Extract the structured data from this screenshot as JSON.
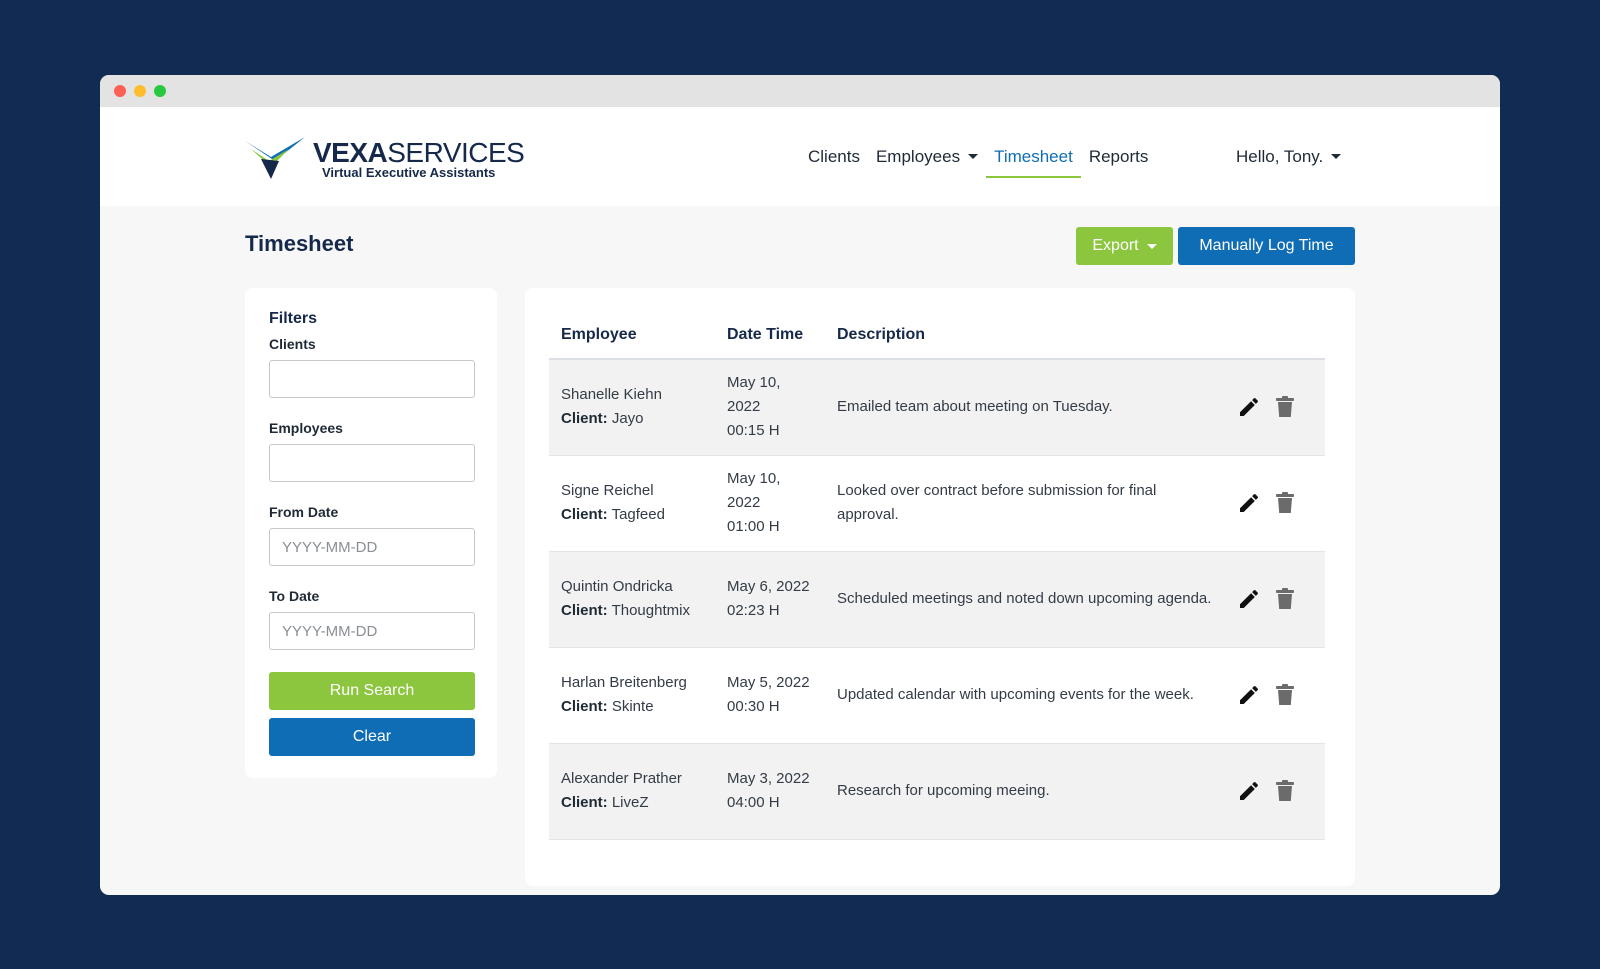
{
  "brand": {
    "name_strong": "VEXA",
    "name_light": "SERVICES",
    "tagline": "Virtual Executive Assistants"
  },
  "nav": {
    "links": [
      {
        "label": "Clients"
      },
      {
        "label": "Employees",
        "dropdown": true
      },
      {
        "label": "Timesheet",
        "active": true
      },
      {
        "label": "Reports"
      }
    ],
    "user_greeting": "Hello, Tony."
  },
  "page": {
    "title": "Timesheet",
    "export_label": "Export",
    "manual_log_label": "Manually Log Time"
  },
  "filters": {
    "title": "Filters",
    "clients_label": "Clients",
    "clients_value": "",
    "employees_label": "Employees",
    "employees_value": "",
    "from_date_label": "From Date",
    "from_date_placeholder": "YYYY-MM-DD",
    "to_date_label": "To Date",
    "to_date_placeholder": "YYYY-MM-DD",
    "run_search_label": "Run Search",
    "clear_label": "Clear"
  },
  "table": {
    "headers": [
      "Employee",
      "Date Time",
      "Description"
    ],
    "client_prefix": "Client:",
    "rows": [
      {
        "employee": "Shanelle Kiehn",
        "client": "Jayo",
        "date": "May 10, 2022",
        "time": "00:15 H",
        "description": "Emailed team about meeting on Tuesday."
      },
      {
        "employee": "Signe Reichel",
        "client": "Tagfeed",
        "date": "May 10, 2022",
        "time": "01:00 H",
        "description": "Looked over contract before submission for final approval."
      },
      {
        "employee": "Quintin Ondricka",
        "client": "Thoughtmix",
        "date": "May 6, 2022",
        "time": "02:23 H",
        "description": "Scheduled meetings and noted down upcoming agenda."
      },
      {
        "employee": "Harlan Breitenberg",
        "client": "Skinte",
        "date": "May 5, 2022",
        "time": "00:30 H",
        "description": "Updated calendar with upcoming events for the week."
      },
      {
        "employee": "Alexander Prather",
        "client": "LiveZ",
        "date": "May 3, 2022",
        "time": "04:00 H",
        "description": "Research for upcoming meeing."
      }
    ]
  },
  "icons": {
    "edit": "pencil-icon",
    "delete": "trash-icon"
  },
  "colors": {
    "background": "#112b52",
    "accent_green": "#8cc63e",
    "primary_blue": "#0f6db5",
    "navy": "#16294a"
  }
}
